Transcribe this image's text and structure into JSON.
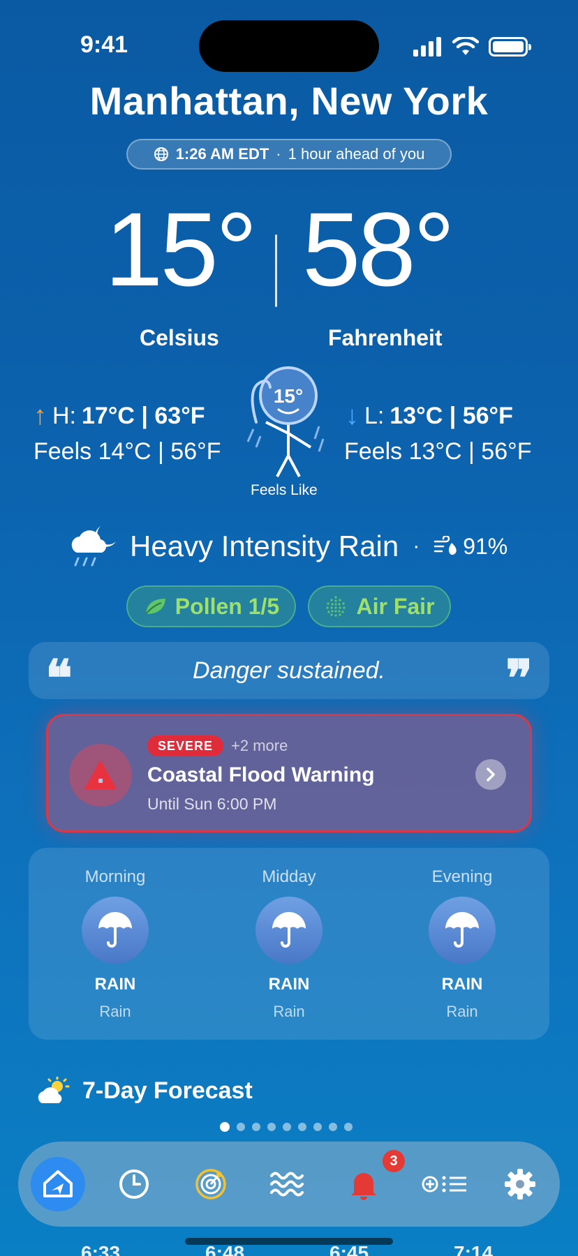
{
  "status_bar": {
    "time": "9:41"
  },
  "location": {
    "city": "Manhattan, New York",
    "local_time": "1:26 AM EDT",
    "offset_text": "1 hour ahead of you"
  },
  "temperature": {
    "celsius": "15°",
    "fahrenheit": "58°",
    "celsius_label": "Celsius",
    "fahrenheit_label": "Fahrenheit",
    "high_prefix": "H:",
    "high_value": "17°C | 63°F",
    "high_feels": "Feels 14°C | 56°F",
    "low_prefix": "L:",
    "low_value": "13°C | 56°F",
    "low_feels": "Feels 13°C | 56°F",
    "feels_like_badge": "15°",
    "feels_like_label": "Feels Like"
  },
  "condition": {
    "text": "Heavy Intensity Rain",
    "separator": "·",
    "precip": "91%"
  },
  "pills": {
    "pollen": "Pollen 1/5",
    "air": "Air Fair"
  },
  "quote": {
    "open": "❝",
    "text": "Danger sustained.",
    "close": "❞"
  },
  "alert": {
    "badge": "SEVERE",
    "more": "+2 more",
    "title": "Coastal Flood Warning",
    "until": "Until Sun 6:00 PM"
  },
  "periods": [
    {
      "name": "Morning",
      "condition": "RAIN",
      "sub": "Rain"
    },
    {
      "name": "Midday",
      "condition": "RAIN",
      "sub": "Rain"
    },
    {
      "name": "Evening",
      "condition": "RAIN",
      "sub": "Rain"
    }
  ],
  "forecast": {
    "title": "7-Day Forecast"
  },
  "tabbar": {
    "notification_count": "3"
  },
  "bottom_times": [
    "6:33",
    "6:48",
    "6:45",
    "7:14"
  ],
  "colors": {
    "accent": "#2e8cf0",
    "severe": "#e02c3a",
    "pollen_green": "#9fe06a"
  }
}
